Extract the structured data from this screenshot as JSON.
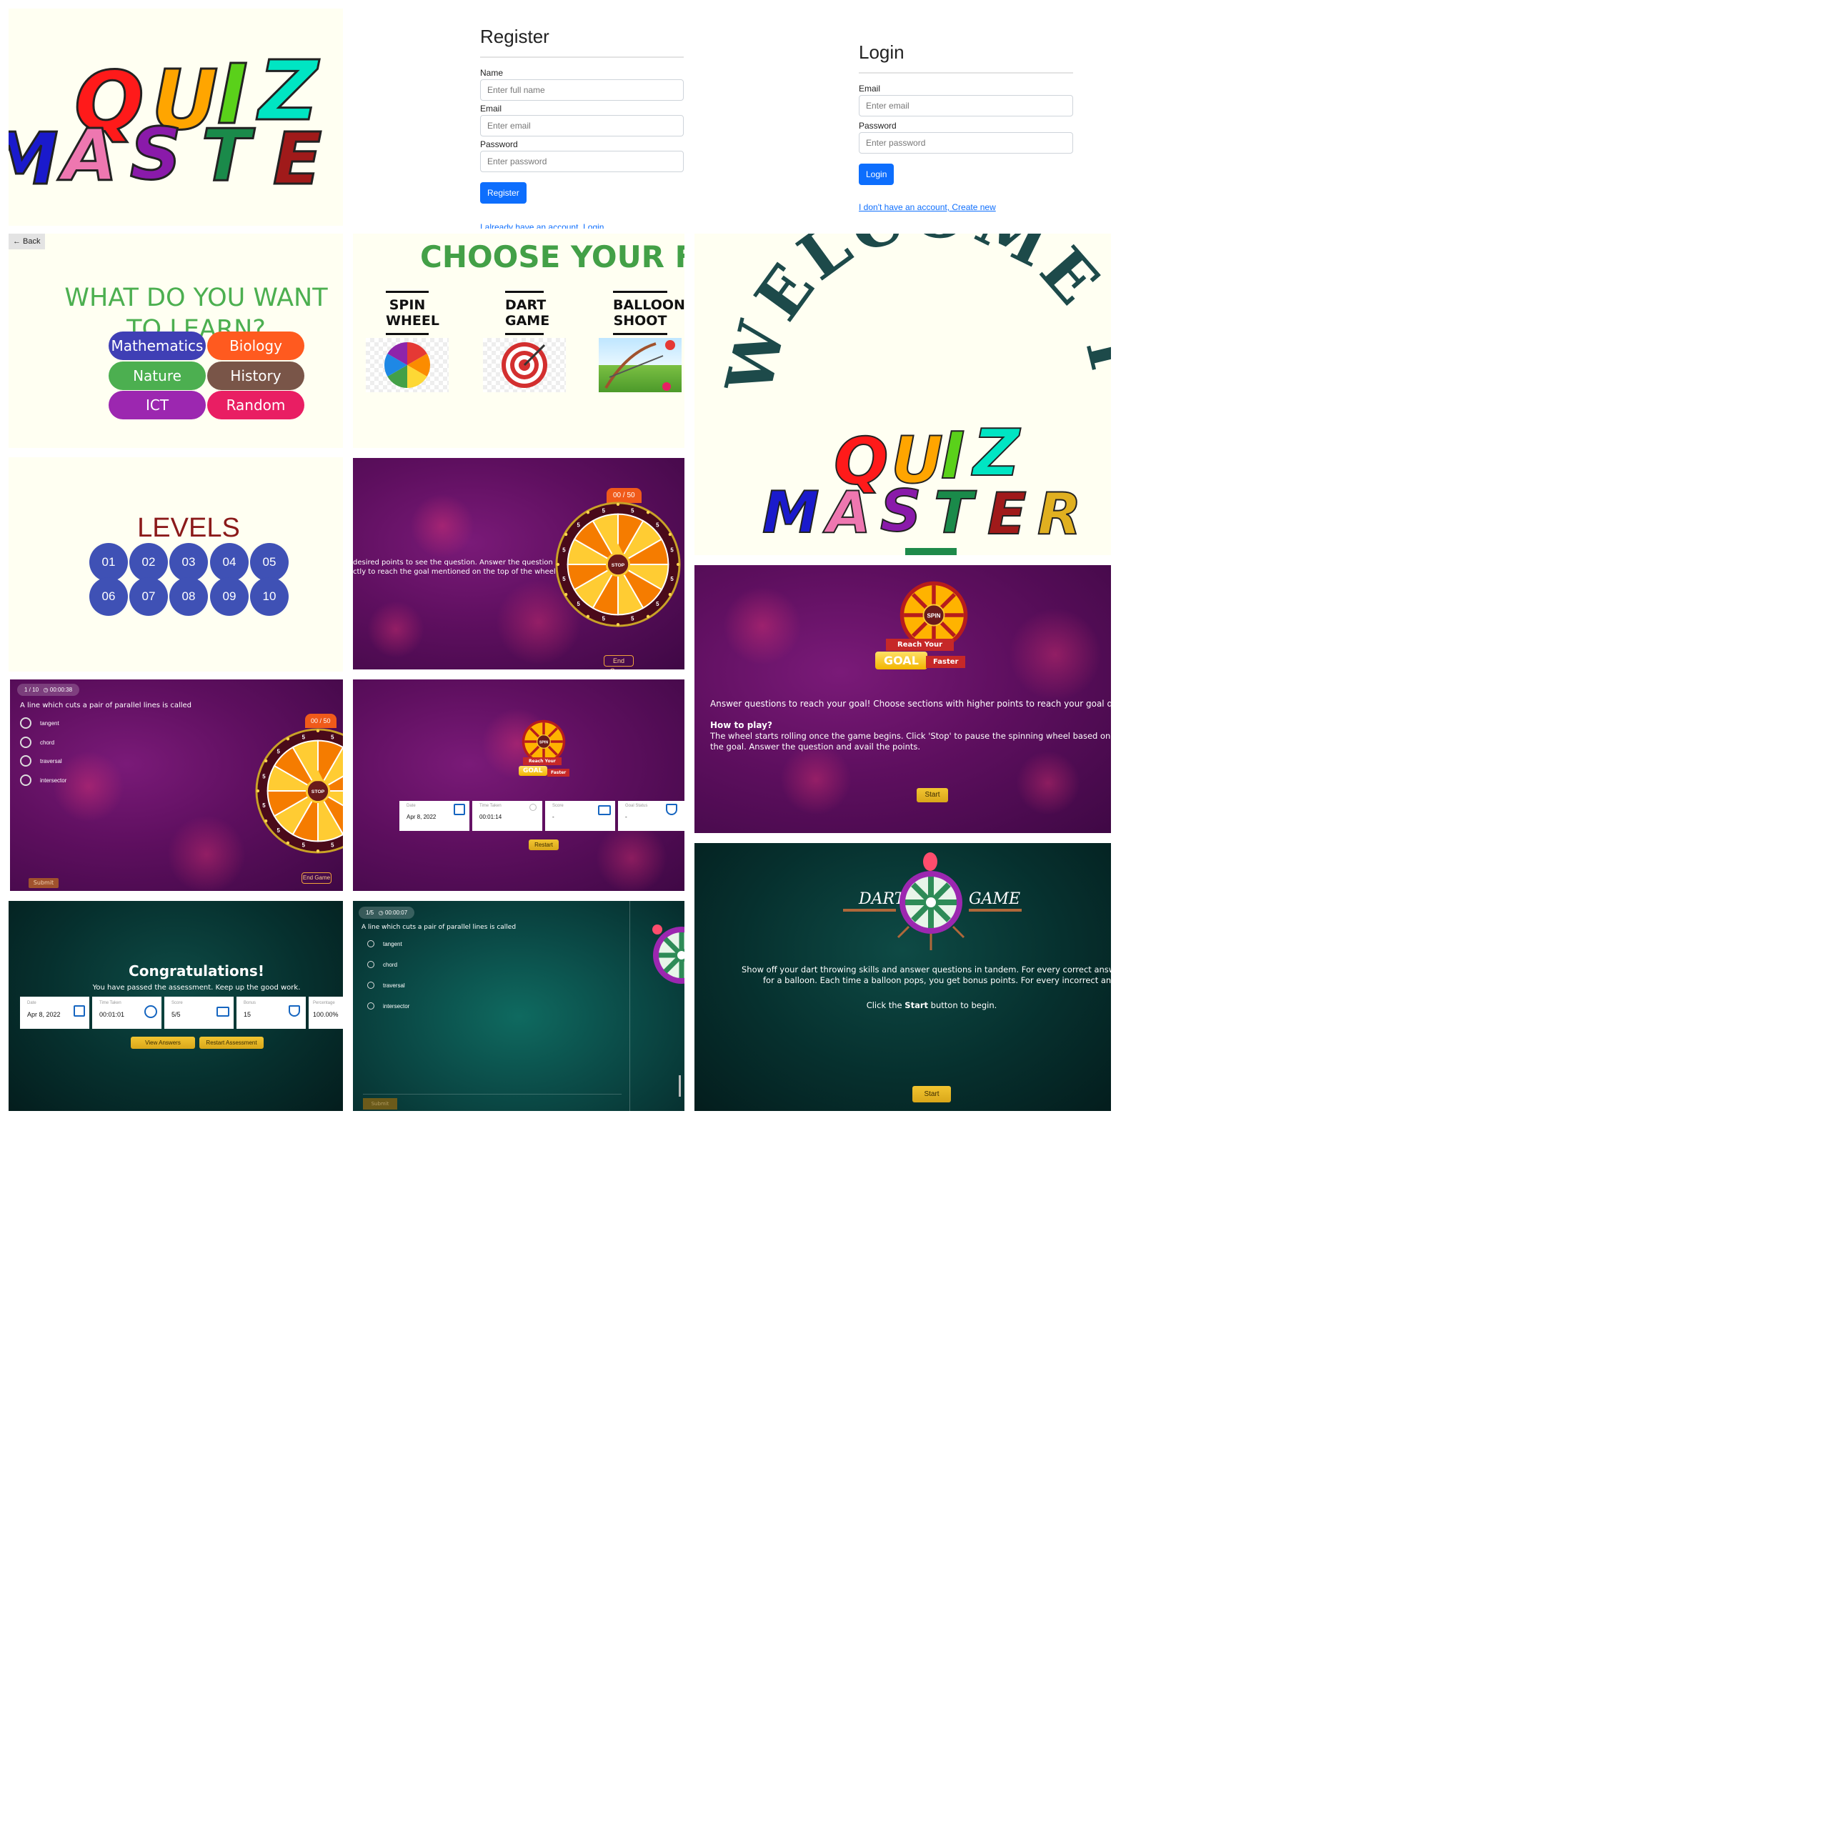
{
  "logo_tile": {
    "line1": "QUIZ",
    "line2": "MASTER"
  },
  "register": {
    "title": "Register",
    "name_label": "Name",
    "name_placeholder": "Enter full name",
    "email_label": "Email",
    "email_placeholder": "Enter email",
    "password_label": "Password",
    "password_placeholder": "Enter password",
    "button": "Register",
    "link": "I already have an account, Login"
  },
  "login": {
    "title": "Login",
    "email_label": "Email",
    "email_placeholder": "Enter email",
    "password_label": "Password",
    "password_placeholder": "Enter password",
    "button": "Login",
    "link": "I don't have an account, Create new"
  },
  "subjects": {
    "back": "← Back",
    "title_line1": "WHAT DO YOU WANT",
    "title_line2": "TO LEARN?",
    "items": [
      {
        "label": "Mathematics",
        "color": "#3f3fb5"
      },
      {
        "label": "Biology",
        "color": "#ff5a1f"
      },
      {
        "label": "Nature",
        "color": "#4caf50"
      },
      {
        "label": "History",
        "color": "#795548"
      },
      {
        "label": "ICT",
        "color": "#9c27b0"
      },
      {
        "label": "Random",
        "color": "#e91e63"
      }
    ]
  },
  "games": {
    "title": "CHOOSE YOUR FAVOURITE G",
    "items": [
      {
        "label_line1": "SPIN",
        "label_line2": "WHEEL"
      },
      {
        "label_line1": "DART",
        "label_line2": "GAME"
      },
      {
        "label_line1": "BALLOON",
        "label_line2": "SHOOT"
      }
    ]
  },
  "welcome": {
    "arc_text": "WELCOME TO",
    "logo_line1": "QUIZ",
    "logo_line2": "MASTER"
  },
  "levels": {
    "title": "LEVELS",
    "items": [
      "01",
      "02",
      "03",
      "04",
      "05",
      "06",
      "07",
      "08",
      "09",
      "10"
    ]
  },
  "spin_play": {
    "instructions_line1": "desired points to see the question. Answer the question",
    "instructions_line2": "ctly to reach the goal mentioned on the top of the wheel",
    "score_badge": "00 / 50",
    "stop": "STOP",
    "end_game": "End Game",
    "segment_value": "5"
  },
  "spin_intro": {
    "spin": "SPIN",
    "reach_your": "Reach Your",
    "goal": "GOAL",
    "faster": "Faster",
    "description": "Answer questions to reach your goal! Choose sections with higher points to reach your goal quicker.",
    "how_title": "How to play?",
    "how_line1": "The wheel starts rolling once the game begins. Click 'Stop' to pause the spinning wheel based on the points needed",
    "how_line2": "the goal. Answer the question and avail the points.",
    "start": "Start"
  },
  "spin_question": {
    "counter": "1 / 10",
    "timer": "00:00:38",
    "question": "A line which cuts a pair of parallel lines is called",
    "options": [
      "tangent",
      "chord",
      "traversal",
      "intersector"
    ],
    "score_badge": "00 / 50",
    "stop": "STOP",
    "submit": "Submit",
    "end_game": "End Game"
  },
  "spin_result": {
    "spin": "SPIN",
    "reach_your": "Reach Your",
    "goal": "GOAL",
    "faster": "Faster",
    "cards": [
      {
        "key": "Date",
        "value": "Apr 8, 2022",
        "icon": "calendar-icon"
      },
      {
        "key": "Time Taken",
        "value": "00:01:14",
        "icon": "clock-icon"
      },
      {
        "key": "Score",
        "value": "-",
        "icon": "score-board-icon"
      },
      {
        "key": "Goal Status",
        "value": "-",
        "icon": "trophy-icon"
      }
    ],
    "restart": "Restart"
  },
  "congrats": {
    "title": "Congratulations!",
    "subtitle": "You have passed the assessment. Keep up the good work.",
    "cards": [
      {
        "key": "Date",
        "value": "Apr 8, 2022",
        "icon": "calendar-icon"
      },
      {
        "key": "Time Taken",
        "value": "00:01:01",
        "icon": "clock-icon"
      },
      {
        "key": "Score",
        "value": "5/5",
        "icon": "score-board-icon"
      },
      {
        "key": "Bonus",
        "value": "15",
        "icon": "trophy-icon"
      },
      {
        "key": "Percentage",
        "value": "100.00%",
        "icon": ""
      }
    ],
    "view_answers": "View Answers",
    "restart": "Restart Assessment"
  },
  "dart_question": {
    "counter": "1/5",
    "timer": "00:00:07",
    "question": "A line which cuts a pair of parallel lines is called",
    "options": [
      "tangent",
      "chord",
      "traversal",
      "intersector"
    ],
    "submit": "Submit"
  },
  "dart_intro": {
    "dart": "DART",
    "game": "GAME",
    "line1": "Show off your dart throwing skills and answer questions in tandem. For every correct answer, you get to throw a d",
    "line2": "for a balloon. Each time a balloon pops, you get bonus points. For every incorrect answer, you lose a da",
    "click_pre": "Click the ",
    "click_bold": "Start",
    "click_post": " button to begin.",
    "start": "Start"
  }
}
